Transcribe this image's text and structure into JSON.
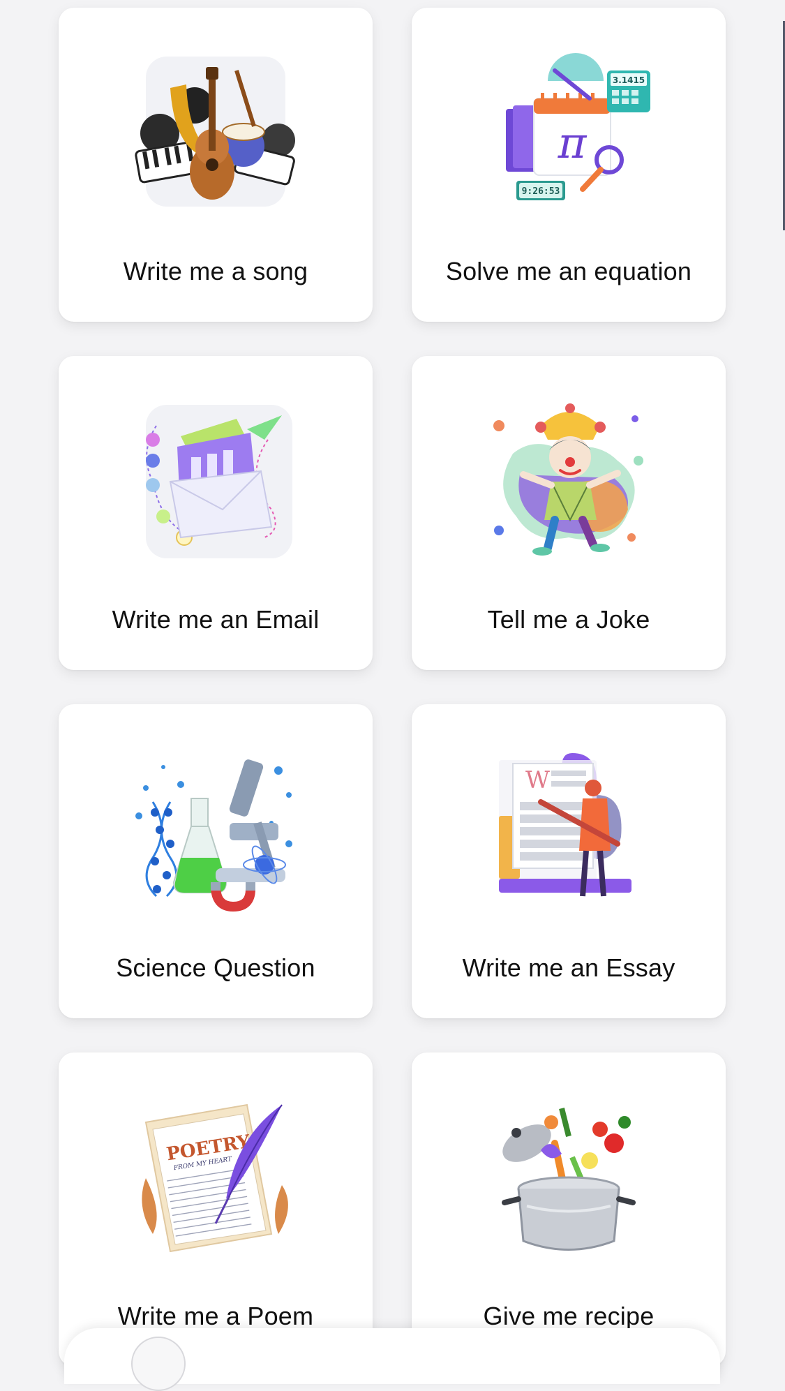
{
  "cards": [
    {
      "label": "Write me a song",
      "icon": "music-instruments-icon"
    },
    {
      "label": "Solve me an equation",
      "icon": "math-pi-calendar-icon"
    },
    {
      "label": "Write me an Email",
      "icon": "email-envelope-icon"
    },
    {
      "label": "Tell me a Joke",
      "icon": "jester-clown-icon"
    },
    {
      "label": "Science Question",
      "icon": "science-lab-icon"
    },
    {
      "label": "Write me an Essay",
      "icon": "essay-document-icon"
    },
    {
      "label": "Write me a Poem",
      "icon": "poetry-quill-icon"
    },
    {
      "label": "Give me recipe",
      "icon": "cooking-pot-icon"
    }
  ],
  "art_text": {
    "equation_pi": "π",
    "equation_number": "3.1415",
    "equation_time": "9:26:53",
    "essay_letter": "W",
    "poetry_title": "POETRY",
    "poetry_subtitle": "FROM MY HEART"
  },
  "colors": {
    "background": "#f3f3f5",
    "card": "#ffffff",
    "accent_purple": "#7a5af8",
    "label_text": "#111111"
  }
}
